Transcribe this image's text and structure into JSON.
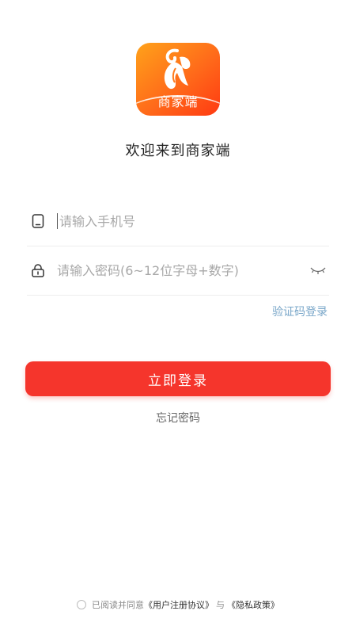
{
  "logo": {
    "label": "商家端",
    "icon": "goat-icon"
  },
  "welcome": "欢迎来到商家端",
  "phone": {
    "placeholder": "请输入手机号",
    "icon": "phone-icon"
  },
  "password": {
    "placeholder": "请输入密码(6~12位字母+数字)",
    "icon": "lock-icon",
    "toggle_icon": "eye-closed-icon"
  },
  "sms_login": "验证码登录",
  "login_button": "立即登录",
  "forgot_password": "忘记密码",
  "agreement": {
    "prefix": "已阅读并同意",
    "terms": "《用户注册协议》",
    "and": "与",
    "privacy": "《隐私政策》"
  },
  "colors": {
    "primary": "#f5352c",
    "link": "#7aa7c9",
    "logo_gradient_start": "#ffa21a",
    "logo_gradient_end": "#ff3a12"
  }
}
